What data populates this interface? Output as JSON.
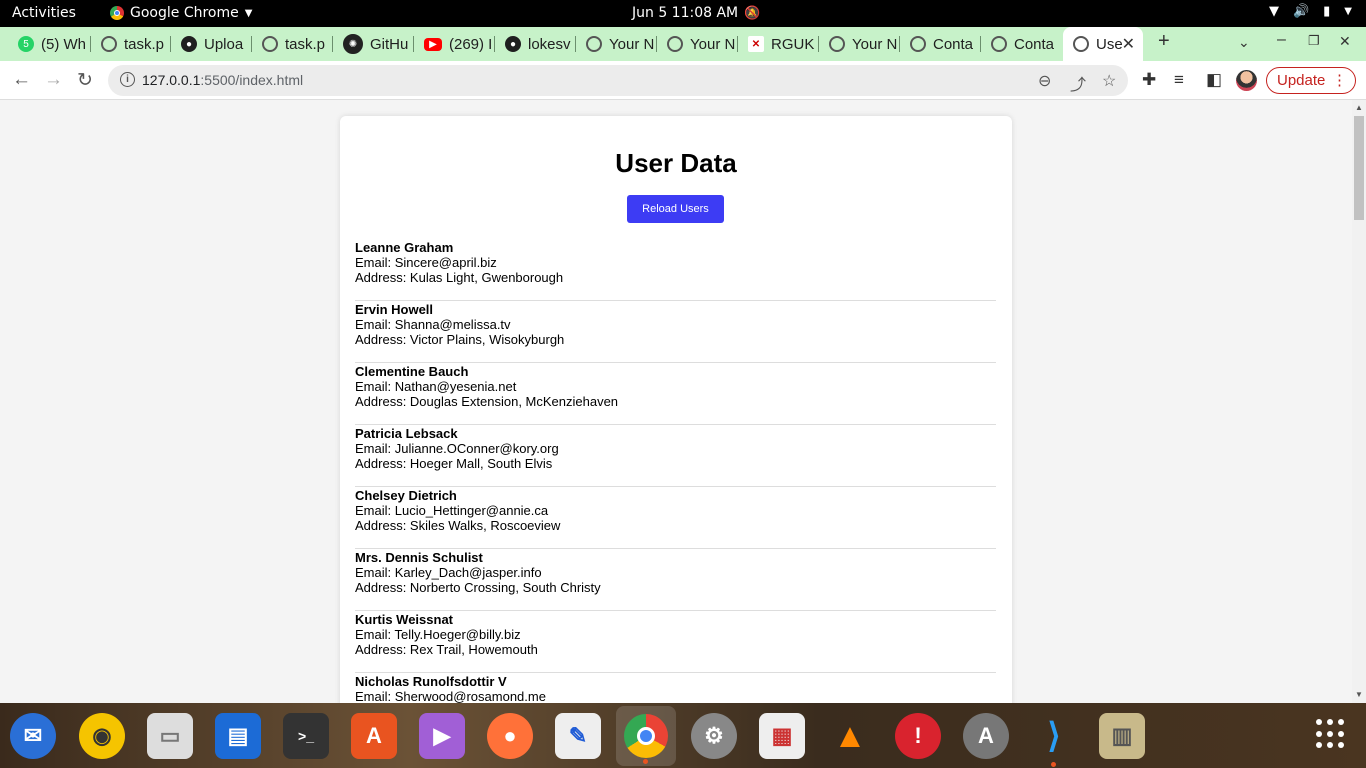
{
  "topbar": {
    "activities": "Activities",
    "app_name": "Google Chrome",
    "clock": "Jun 5  11:08 AM"
  },
  "tabs": [
    {
      "label": "(5) Wh",
      "icon": "whatsapp-icon"
    },
    {
      "label": "task.p",
      "icon": "globe-icon"
    },
    {
      "label": "Uploa",
      "icon": "github-icon"
    },
    {
      "label": "task.p",
      "icon": "globe-icon"
    },
    {
      "label": "GitHu",
      "icon": "chatgpt-icon"
    },
    {
      "label": "(269) I",
      "icon": "youtube-icon"
    },
    {
      "label": "lokesv",
      "icon": "github-icon"
    },
    {
      "label": "Your N",
      "icon": "globe-icon"
    },
    {
      "label": "Your N",
      "icon": "globe-icon"
    },
    {
      "label": "RGUK",
      "icon": "rgukt-icon"
    },
    {
      "label": "Your N",
      "icon": "globe-icon"
    },
    {
      "label": "Conta",
      "icon": "globe-icon"
    },
    {
      "label": "Conta",
      "icon": "globe-icon"
    },
    {
      "label": "Use",
      "icon": "globe-icon",
      "active": true
    }
  ],
  "address_bar": {
    "host": "127.0.0.1",
    "path": ":5500/index.html"
  },
  "update_button": "Update",
  "page": {
    "title": "User Data",
    "reload_button": "Reload Users",
    "users": [
      {
        "name": "Leanne Graham",
        "email": "Email: Sincere@april.biz",
        "address": "Address: Kulas Light, Gwenborough"
      },
      {
        "name": "Ervin Howell",
        "email": "Email: Shanna@melissa.tv",
        "address": "Address: Victor Plains, Wisokyburgh"
      },
      {
        "name": "Clementine Bauch",
        "email": "Email: Nathan@yesenia.net",
        "address": "Address: Douglas Extension, McKenziehaven"
      },
      {
        "name": "Patricia Lebsack",
        "email": "Email: Julianne.OConner@kory.org",
        "address": "Address: Hoeger Mall, South Elvis"
      },
      {
        "name": "Chelsey Dietrich",
        "email": "Email: Lucio_Hettinger@annie.ca",
        "address": "Address: Skiles Walks, Roscoeview"
      },
      {
        "name": "Mrs. Dennis Schulist",
        "email": "Email: Karley_Dach@jasper.info",
        "address": "Address: Norberto Crossing, South Christy"
      },
      {
        "name": "Kurtis Weissnat",
        "email": "Email: Telly.Hoeger@billy.biz",
        "address": "Address: Rex Trail, Howemouth"
      },
      {
        "name": "Nicholas Runolfsdottir V",
        "email": "Email: Sherwood@rosamond.me",
        "address": ""
      }
    ]
  },
  "dock": [
    {
      "icon": "thunderbird-icon"
    },
    {
      "icon": "rhythmbox-icon"
    },
    {
      "icon": "files-icon"
    },
    {
      "icon": "libreoffice-writer-icon"
    },
    {
      "icon": "terminal-icon"
    },
    {
      "icon": "app-center-icon"
    },
    {
      "icon": "video-player-icon"
    },
    {
      "icon": "firefox-icon"
    },
    {
      "icon": "text-editor-icon"
    },
    {
      "icon": "chrome-icon"
    },
    {
      "icon": "settings-icon"
    },
    {
      "icon": "document-viewer-icon"
    },
    {
      "icon": "vlc-icon"
    },
    {
      "icon": "error-report-icon"
    },
    {
      "icon": "software-updater-icon"
    },
    {
      "icon": "vscode-icon"
    },
    {
      "icon": "archive-manager-icon"
    }
  ]
}
